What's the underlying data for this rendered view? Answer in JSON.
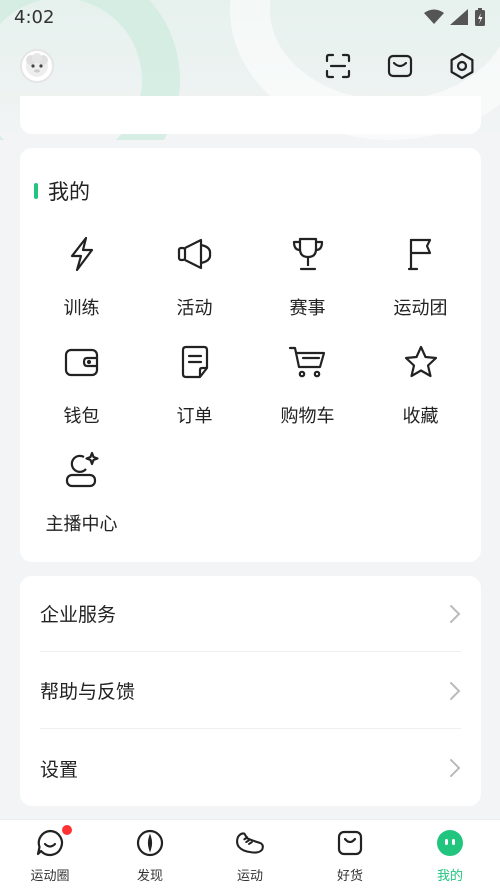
{
  "status": {
    "time": "4:02"
  },
  "mine": {
    "title": "我的",
    "items": [
      {
        "label": "训练",
        "icon": "lightning-icon"
      },
      {
        "label": "活动",
        "icon": "megaphone-icon"
      },
      {
        "label": "赛事",
        "icon": "trophy-icon"
      },
      {
        "label": "运动团",
        "icon": "flag-icon"
      },
      {
        "label": "钱包",
        "icon": "wallet-icon"
      },
      {
        "label": "订单",
        "icon": "order-icon"
      },
      {
        "label": "购物车",
        "icon": "cart-icon"
      },
      {
        "label": "收藏",
        "icon": "star-icon"
      },
      {
        "label": "主播中心",
        "icon": "streamer-icon"
      }
    ]
  },
  "menu": {
    "items": [
      {
        "label": "企业服务"
      },
      {
        "label": "帮助与反馈"
      },
      {
        "label": "设置"
      }
    ]
  },
  "tabs": [
    {
      "label": "运动圈",
      "icon": "chat-bubble-icon",
      "badge": true
    },
    {
      "label": "发现",
      "icon": "compass-icon"
    },
    {
      "label": "运动",
      "icon": "sneaker-icon"
    },
    {
      "label": "好货",
      "icon": "bag-icon"
    },
    {
      "label": "我的",
      "icon": "face-icon",
      "active": true
    }
  ],
  "colors": {
    "accent": "#21c57e",
    "badge": "#ff3333"
  }
}
